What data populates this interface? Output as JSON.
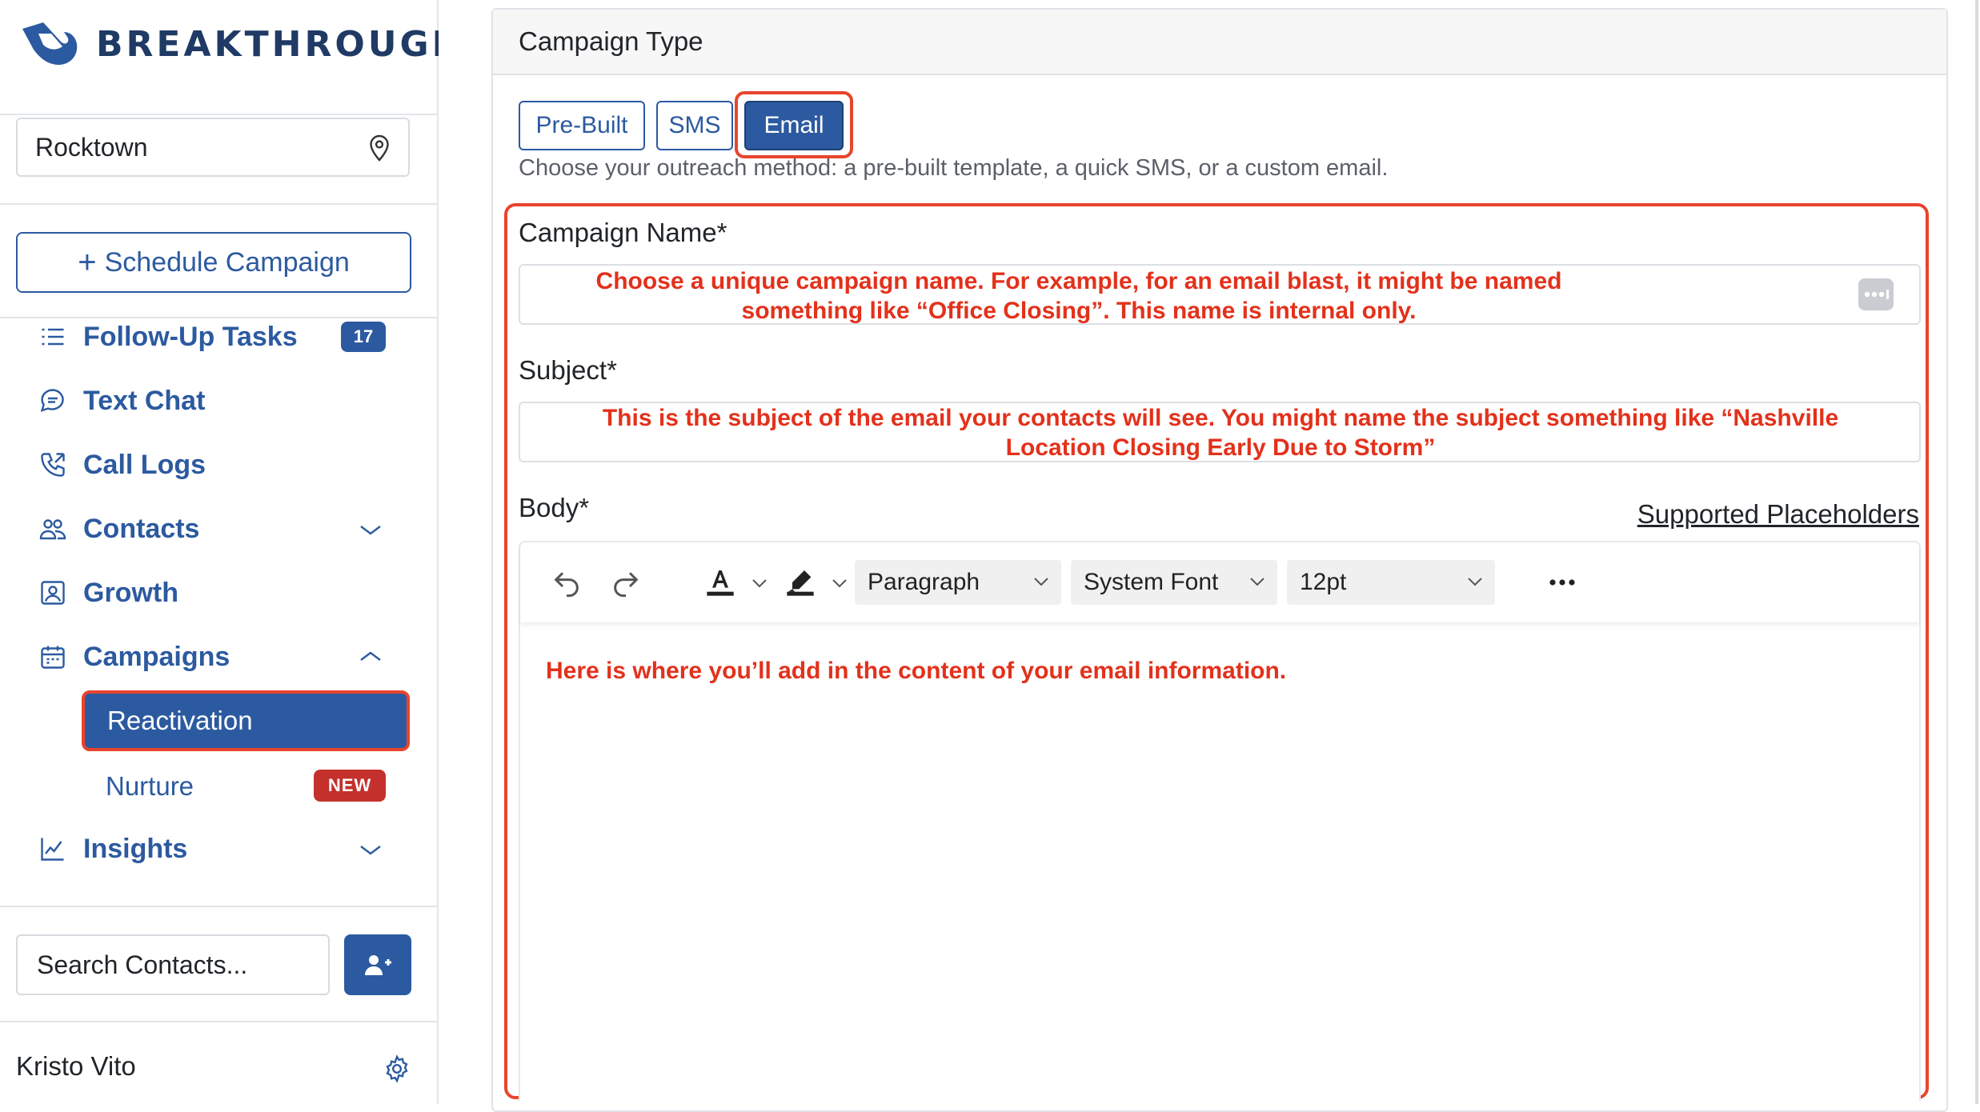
{
  "brand": {
    "name": "BREAKTHROUGH",
    "color": "#1f3a64"
  },
  "sidebar": {
    "location": "Rocktown",
    "schedule_button": "Schedule Campaign",
    "nav": [
      {
        "label": "Follow-Up Tasks",
        "icon": "list-icon",
        "badge": "17"
      },
      {
        "label": "Text Chat",
        "icon": "chat-icon"
      },
      {
        "label": "Call Logs",
        "icon": "phone-icon"
      },
      {
        "label": "Contacts",
        "icon": "people-icon",
        "expand": "chevron-down-icon"
      },
      {
        "label": "Growth",
        "icon": "portrait-icon"
      },
      {
        "label": "Campaigns",
        "icon": "calendar-icon",
        "expand": "chevron-up-icon"
      },
      {
        "label": "Insights",
        "icon": "chart-line-icon",
        "expand": "chevron-down-icon"
      }
    ],
    "campaign_sub": [
      {
        "label": "Reactivation",
        "active": true
      },
      {
        "label": "Nurture",
        "badge": "NEW"
      }
    ],
    "search_placeholder": "Search Contacts...",
    "user_name": "Kristo Vito"
  },
  "main": {
    "card_title": "Campaign Type",
    "type_buttons": [
      "Pre-Built",
      "SMS",
      "Email"
    ],
    "active_type": "Email",
    "helper_text": "Choose your outreach method: a pre-built template, a quick SMS, or a custom email.",
    "campaign_name_label": "Campaign Name*",
    "campaign_name_hint_1": "Choose a unique campaign name. For example, for an email blast, it might be named",
    "campaign_name_hint_2": "something like “Office Closing”. This name is internal only.",
    "subject_label": "Subject*",
    "subject_hint_1": "This is the subject of the email your contacts will see. You might name the subject something like “Nashville",
    "subject_hint_2": "Location Closing Early Due to Storm”",
    "body_label": "Body*",
    "placeholders_link": "Supported Placeholders",
    "toolbar": {
      "block": "Paragraph",
      "font": "System Font",
      "size": "12pt"
    },
    "body_hint": "Here is where you’ll add in the content of your email information."
  },
  "colors": {
    "primary": "#2c5aa0",
    "annotation_red": "#e8452c",
    "badge_red": "#c4302b"
  }
}
